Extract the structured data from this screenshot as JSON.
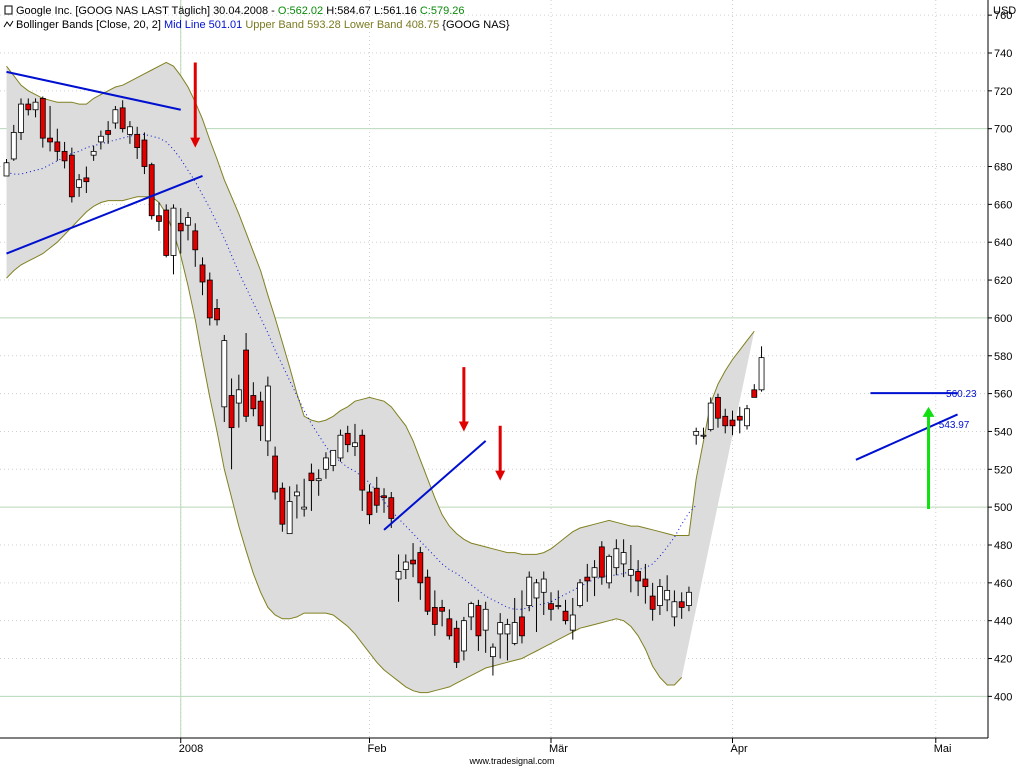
{
  "chart_data": {
    "type": "candlestick",
    "header": {
      "title_prefix": "Google Inc. [GOOG NAS LAST Täglich] 30.04.2008 - ",
      "o_label": "O:562.02",
      "h_label": "H:584.67",
      "l_label": "L:561.16",
      "c_label": "C:579.26",
      "indicator_prefix": "Bollinger Bands [Close, 20, 2] ",
      "mid_label": "Mid Line 501.01",
      "upper_label": "Upper Band 593.28",
      "lower_label": "Lower Band 408.75",
      "indicator_suffix": "{GOOG NAS}"
    },
    "currency_label": "USD",
    "watermark": "www.tradesignal.com",
    "yticks": [
      400,
      420,
      440,
      460,
      480,
      500,
      520,
      540,
      560,
      580,
      600,
      620,
      640,
      660,
      680,
      700,
      720,
      740,
      760
    ],
    "ymin": 378,
    "ymax": 768,
    "major_gridlines": [
      400,
      500,
      600,
      700
    ],
    "xlabels": [
      {
        "label": "2008",
        "i": 24
      },
      {
        "label": "Feb",
        "i": 50
      },
      {
        "label": "Mär",
        "i": 75
      },
      {
        "label": "Apr",
        "i": 100
      },
      {
        "label": "Mai",
        "i": 128
      }
    ],
    "vline_i": 24,
    "candles": [
      [
        675,
        684,
        676,
        682
      ],
      [
        684,
        702,
        683,
        698
      ],
      [
        698,
        716,
        694,
        713
      ],
      [
        713,
        716,
        707,
        710
      ],
      [
        710,
        716,
        706,
        714
      ],
      [
        716,
        717,
        690,
        695
      ],
      [
        695,
        712,
        688,
        693
      ],
      [
        693,
        700,
        683,
        688
      ],
      [
        688,
        693,
        679,
        683
      ],
      [
        686,
        690,
        661,
        664
      ],
      [
        669,
        676,
        664,
        673
      ],
      [
        674,
        680,
        666,
        672
      ],
      [
        686,
        691,
        683,
        688
      ],
      [
        693,
        699,
        689,
        696
      ],
      [
        699,
        704,
        692,
        697
      ],
      [
        703,
        712,
        700,
        710
      ],
      [
        711,
        715,
        698,
        700
      ],
      [
        697,
        704,
        692,
        701
      ],
      [
        697,
        701,
        684,
        690
      ],
      [
        694,
        698,
        676,
        680
      ],
      [
        681,
        682,
        652,
        654
      ],
      [
        654,
        661,
        646,
        651
      ],
      [
        657,
        660,
        632,
        633
      ],
      [
        633,
        660,
        623,
        658
      ],
      [
        650,
        658,
        634,
        646
      ],
      [
        649,
        656,
        641,
        653
      ],
      [
        646,
        650,
        627,
        636
      ],
      [
        628,
        632,
        612,
        619
      ],
      [
        620,
        624,
        596,
        600
      ],
      [
        605,
        610,
        596,
        599
      ],
      [
        553,
        591,
        545,
        588
      ],
      [
        559,
        568,
        520,
        542
      ],
      [
        555,
        570,
        542,
        562
      ],
      [
        583,
        592,
        545,
        548
      ],
      [
        559,
        566,
        548,
        552
      ],
      [
        556,
        561,
        535,
        543
      ],
      [
        535,
        569,
        527,
        564
      ],
      [
        527,
        532,
        504,
        508
      ],
      [
        510,
        513,
        487,
        491
      ],
      [
        486,
        511,
        486,
        503
      ],
      [
        506,
        512,
        494,
        508
      ],
      [
        499,
        515,
        495,
        500
      ],
      [
        518,
        523,
        498,
        514
      ],
      [
        514,
        520,
        506,
        515
      ],
      [
        520,
        529,
        515,
        526
      ],
      [
        522,
        530,
        519,
        530
      ],
      [
        526,
        541,
        524,
        538
      ],
      [
        539,
        543,
        529,
        533
      ],
      [
        532,
        544,
        527,
        534
      ],
      [
        538,
        541,
        498,
        509
      ],
      [
        508,
        512,
        491,
        496
      ],
      [
        510,
        516,
        497,
        501
      ],
      [
        506,
        510,
        497,
        505
      ],
      [
        505,
        508,
        489,
        494
      ],
      [
        462,
        475,
        450,
        466
      ],
      [
        467,
        475,
        462,
        471
      ],
      [
        472,
        481,
        463,
        470
      ],
      [
        476,
        479,
        451,
        460
      ],
      [
        463,
        467,
        443,
        445
      ],
      [
        447,
        456,
        432,
        438
      ],
      [
        447,
        451,
        437,
        445
      ],
      [
        441,
        446,
        430,
        432
      ],
      [
        436,
        440,
        415,
        418
      ],
      [
        424,
        442,
        419,
        440
      ],
      [
        442,
        450,
        435,
        449
      ],
      [
        448,
        451,
        424,
        432
      ],
      [
        435,
        450,
        423,
        446
      ],
      [
        421,
        428,
        411,
        426
      ],
      [
        433,
        444,
        420,
        439
      ],
      [
        433,
        441,
        419,
        438
      ],
      [
        428,
        452,
        427,
        439
      ],
      [
        442,
        456,
        428,
        432
      ],
      [
        448,
        466,
        445,
        463
      ],
      [
        452,
        462,
        434,
        460
      ],
      [
        455,
        466,
        443,
        462
      ],
      [
        449,
        455,
        440,
        446
      ],
      [
        448,
        456,
        446,
        448
      ],
      [
        445,
        451,
        438,
        440
      ],
      [
        435,
        452,
        430,
        443
      ],
      [
        448,
        462,
        447,
        460
      ],
      [
        463,
        470,
        450,
        461
      ],
      [
        463,
        472,
        453,
        468
      ],
      [
        479,
        482,
        459,
        463
      ],
      [
        460,
        475,
        457,
        474
      ],
      [
        468,
        483,
        464,
        478
      ],
      [
        470,
        483,
        463,
        476
      ],
      [
        464,
        480,
        455,
        467
      ],
      [
        466,
        472,
        453,
        461
      ],
      [
        462,
        470,
        449,
        458
      ],
      [
        453,
        460,
        440,
        446
      ],
      [
        448,
        462,
        443,
        458
      ],
      [
        451,
        464,
        445,
        456
      ],
      [
        442,
        456,
        437,
        450
      ],
      [
        450,
        455,
        441,
        447
      ],
      [
        448,
        458,
        445,
        455
      ],
      [
        538,
        542,
        533,
        540
      ],
      [
        538,
        542,
        536,
        538
      ],
      [
        541,
        558,
        540,
        555
      ],
      [
        558,
        560,
        542,
        547
      ],
      [
        548,
        552,
        539,
        543
      ],
      [
        546,
        551,
        538,
        543
      ],
      [
        548,
        553,
        539,
        546
      ],
      [
        543,
        554,
        541,
        552
      ],
      [
        562,
        565,
        561,
        558
      ],
      [
        562,
        585,
        561,
        579
      ]
    ],
    "candle_x_index": [
      0,
      1,
      2,
      3,
      4,
      5,
      6,
      7,
      8,
      9,
      10,
      11,
      12,
      13,
      14,
      15,
      16,
      17,
      18,
      19,
      20,
      21,
      22,
      23,
      24,
      25,
      26,
      27,
      28,
      29,
      30,
      31,
      32,
      33,
      34,
      35,
      36,
      37,
      38,
      39,
      40,
      41,
      42,
      43,
      44,
      45,
      46,
      47,
      48,
      49,
      50,
      51,
      52,
      53,
      54,
      55,
      56,
      57,
      58,
      59,
      60,
      61,
      62,
      63,
      64,
      65,
      66,
      67,
      68,
      69,
      70,
      71,
      72,
      73,
      74,
      75,
      76,
      77,
      78,
      79,
      80,
      81,
      82,
      83,
      84,
      85,
      86,
      87,
      88,
      89,
      90,
      91,
      92,
      93,
      94,
      95,
      96,
      97,
      98,
      99,
      100,
      101,
      102,
      103,
      104,
      105,
      106
    ],
    "upper_band": [
      733,
      728,
      723,
      720,
      718,
      716,
      715,
      714,
      714,
      714,
      713,
      713,
      716,
      718,
      720,
      722,
      723,
      725,
      727,
      729,
      731,
      733,
      735,
      733,
      728,
      722,
      714,
      705,
      694,
      684,
      673,
      664,
      655,
      645,
      635,
      625,
      612,
      600,
      587,
      574,
      560,
      548,
      546,
      545,
      546,
      548,
      551,
      553,
      556,
      557,
      558,
      557,
      556,
      553,
      548,
      543,
      535,
      525,
      515,
      505,
      496,
      490,
      486,
      483,
      481,
      480,
      479,
      478,
      477,
      476,
      476,
      475,
      475,
      475,
      476,
      478,
      481,
      484,
      487,
      489,
      490,
      491,
      492,
      493,
      492,
      491,
      490,
      490,
      489,
      488,
      487,
      486,
      485,
      485,
      485,
      515,
      535,
      555,
      565,
      572,
      578,
      583,
      588,
      593
    ],
    "lower_band": [
      621,
      625,
      628,
      630,
      632,
      634,
      637,
      640,
      644,
      648,
      652,
      656,
      659,
      661,
      662,
      662,
      662,
      663,
      664,
      664,
      664,
      661,
      655,
      645,
      633,
      617,
      599,
      578,
      558,
      540,
      520,
      505,
      490,
      477,
      465,
      455,
      447,
      443,
      441,
      441,
      442,
      444,
      444,
      444,
      444,
      443,
      440,
      437,
      433,
      428,
      423,
      418,
      414,
      411,
      408,
      405,
      403,
      402,
      402,
      403,
      404,
      405,
      407,
      409,
      411,
      413,
      415,
      416,
      417,
      418,
      419,
      420,
      422,
      424,
      426,
      428,
      430,
      432,
      434,
      436,
      437,
      438,
      439,
      440,
      441,
      440,
      437,
      432,
      425,
      416,
      410,
      406,
      406,
      410
    ],
    "band_index_start": 0,
    "mid_line": [
      677,
      676,
      676,
      677,
      678,
      679,
      681,
      683,
      685,
      687,
      688,
      690,
      691,
      692,
      693,
      694,
      695,
      696,
      697,
      697,
      696,
      695,
      693,
      689,
      684,
      678,
      672,
      665,
      658,
      650,
      642,
      633,
      624,
      616,
      608,
      600,
      592,
      583,
      575,
      567,
      559,
      551,
      544,
      538,
      532,
      527,
      524,
      521,
      519,
      516,
      513,
      508,
      503,
      498,
      494,
      490,
      486,
      482,
      478,
      474,
      470,
      467,
      465,
      462,
      459,
      456,
      453,
      451,
      449,
      447,
      446,
      446,
      447,
      448,
      449,
      450,
      452,
      454,
      456,
      458,
      460,
      462,
      463,
      464,
      464,
      465,
      466,
      467,
      468,
      470,
      474,
      479,
      484,
      491,
      497,
      501
    ],
    "trendlines": [
      {
        "color": "#0010d0",
        "points": [
          [
            0,
            730
          ],
          [
            24,
            710
          ]
        ]
      },
      {
        "color": "#0010d0",
        "points": [
          [
            0,
            634
          ],
          [
            27,
            675
          ]
        ]
      },
      {
        "color": "#0010d0",
        "points": [
          [
            52,
            488
          ],
          [
            66,
            535
          ]
        ]
      },
      {
        "color": "#0010d0",
        "points": [
          [
            117,
            525
          ],
          [
            131,
            549
          ]
        ]
      },
      {
        "color": "#0010d0",
        "points": [
          [
            119,
            560.23
          ],
          [
            131,
            560.23
          ]
        ]
      }
    ],
    "price_tags": [
      {
        "text": "560.23",
        "value": 560.23,
        "i": 129
      },
      {
        "text": "543.97",
        "value": 543.97,
        "i": 128
      }
    ],
    "arrows_down": [
      {
        "i": 26,
        "from": 735,
        "to": 690
      },
      {
        "i": 63,
        "from": 574,
        "to": 540
      },
      {
        "i": 68,
        "from": 543,
        "to": 514
      }
    ],
    "arrow_up": {
      "i": 127,
      "from": 499,
      "to": 553
    }
  }
}
